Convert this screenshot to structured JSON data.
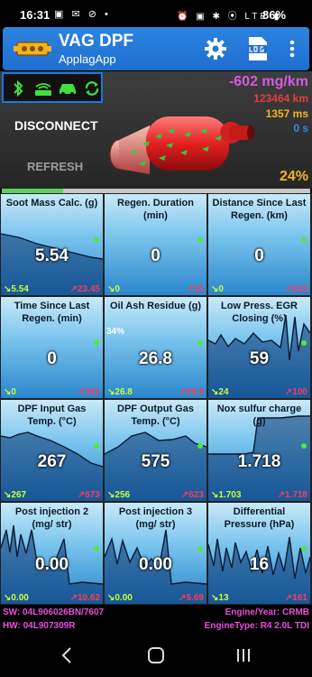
{
  "status": {
    "time": "16:31",
    "left_icons": "▣ ✉ ⊘ •",
    "right_icons": "⏰ ▣ ✱ ⦿ LTE ▮",
    "battery": "86%"
  },
  "app": {
    "title": "VAG DPF",
    "subtitle": "ApplagApp",
    "icons": [
      "engine-logo-icon",
      "gear-icon",
      "log-icon",
      "more-vert-icon"
    ]
  },
  "panel": {
    "connection_icons": [
      "bluetooth-icon",
      "obd-adapter-icon",
      "car-icon",
      "sync-icon"
    ],
    "disconnect_label": "DISCONNECT",
    "refresh_label": "REFRESH",
    "soot_rate": "-602 mg/km",
    "distance": "123464 km",
    "time": "1357 ms",
    "seconds": "0 s",
    "percent": "24%",
    "progress": 0.2,
    "colors": {
      "soot_rate": "#d15be0",
      "distance": "#e53e3e",
      "time": "#f3b320",
      "seconds": "#2e8de6",
      "percent": "#f3b320"
    }
  },
  "cells": [
    {
      "title": "Soot Mass Calc. (g)",
      "value": "5.54",
      "min": "↘5.54",
      "max": "↗23.45",
      "extra": ""
    },
    {
      "title": "Regen. Duration (min)",
      "value": "0",
      "min": "↘0",
      "max": "↗15",
      "extra": ""
    },
    {
      "title": "Distance Since Last Regen. (km)",
      "value": "0",
      "min": "↘0",
      "max": "↗223",
      "extra": ""
    },
    {
      "title": "Time Since Last Regen. (min)",
      "value": "0",
      "min": "↘0",
      "max": "↗341",
      "extra": ""
    },
    {
      "title": "Oil Ash Residue (g)",
      "value": "26.8",
      "min": "↘26.8",
      "max": "↗26.8",
      "extra": "34%"
    },
    {
      "title": "Low Press. EGR Closing (%)",
      "value": "59",
      "min": "↘24",
      "max": "↗100",
      "extra": ""
    },
    {
      "title": "DPF Input Gas Temp. (°C)",
      "value": "267",
      "min": "↘267",
      "max": "↗673",
      "extra": ""
    },
    {
      "title": "DPF Output Gas Temp. (°C)",
      "value": "575",
      "min": "↘256",
      "max": "↗623",
      "extra": ""
    },
    {
      "title": "Nox sulfur charge (g)",
      "value": "1.718",
      "min": "↘1.703",
      "max": "↗1.718",
      "extra": ""
    },
    {
      "title": "Post injection 2 (mg/ str)",
      "value": "0.00",
      "min": "↘0.00",
      "max": "↗10.62",
      "extra": ""
    },
    {
      "title": "Post injection 3 (mg/ str)",
      "value": "0.00",
      "min": "↘0.00",
      "max": "↗5.69",
      "extra": ""
    },
    {
      "title": "Differential Pressure (hPa)",
      "value": "16",
      "min": "↘13",
      "max": "↗161",
      "extra": ""
    }
  ],
  "footer": {
    "sw": "SW: 04L906026BN/7607",
    "hw": "HW: 04L907309R",
    "engine_year": "Engine/Year: CRMB",
    "engine_type": "EngineType: R4 2.0L TDI"
  },
  "navbar": {
    "icons": [
      "back-icon",
      "home-icon",
      "recents-icon"
    ]
  }
}
